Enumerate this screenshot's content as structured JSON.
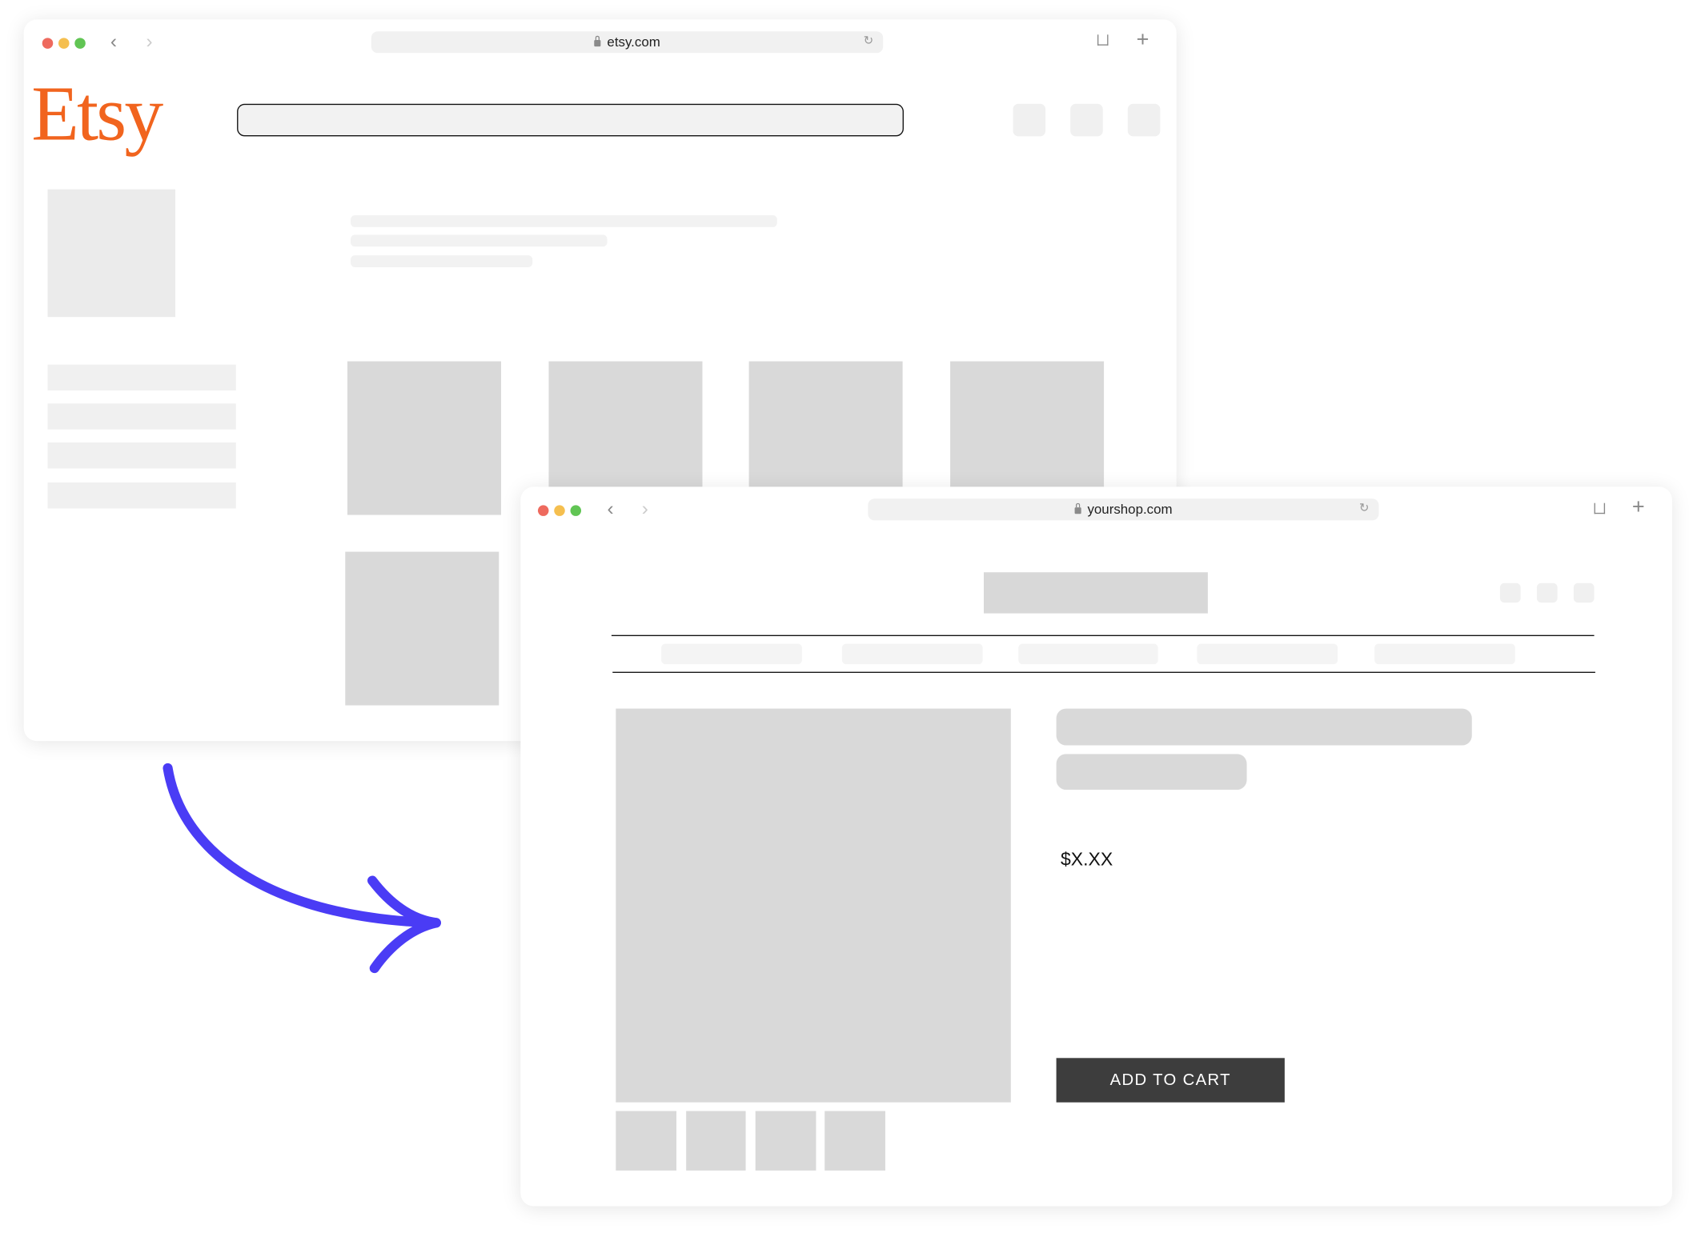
{
  "window_back": {
    "url": "etsy.com",
    "logo_text": "Etsy",
    "brand_color": "#F1641E",
    "icons": [
      "lock-icon",
      "reload-icon",
      "share-icon",
      "new-tab-icon",
      "back-icon",
      "forward-icon"
    ]
  },
  "window_front": {
    "url": "yourshop.com",
    "price": "$X.XX",
    "add_to_cart_label": "ADD TO CART",
    "button_color": "#3D3D3D"
  },
  "arrow_color": "#4A3CF5"
}
